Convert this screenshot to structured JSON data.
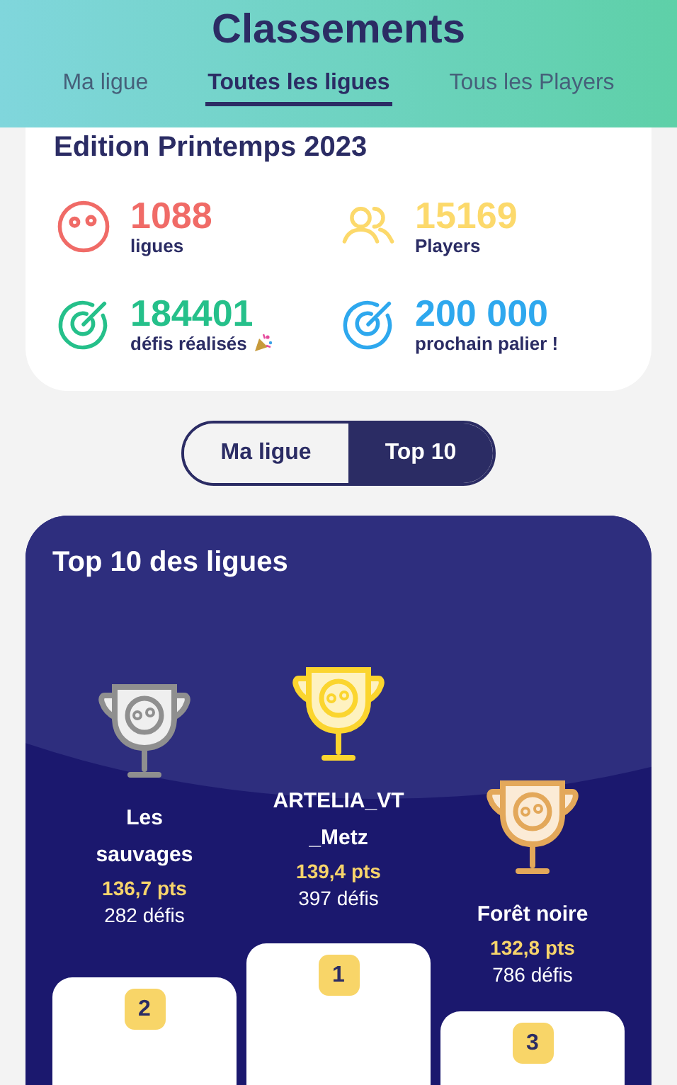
{
  "header": {
    "title": "Classements"
  },
  "tabs": [
    {
      "label": "Ma ligue",
      "selected": false
    },
    {
      "label": "Toutes les ligues",
      "selected": true
    },
    {
      "label": "Tous les Players",
      "selected": false
    }
  ],
  "edition": {
    "title": "Edition Printemps 2023",
    "stats": [
      {
        "kind": "face",
        "color": "#f06b67",
        "value": "1088",
        "label": "ligues"
      },
      {
        "kind": "people",
        "color": "#fcd96b",
        "value": "15169",
        "label": "Players"
      },
      {
        "kind": "target",
        "color": "#25c08a",
        "value": "184401",
        "label": "défis réalisés",
        "party": true
      },
      {
        "kind": "target",
        "color": "#2ea8ee",
        "value": "200 000",
        "label": "prochain palier !"
      }
    ]
  },
  "toggle": [
    {
      "label": "Ma ligue",
      "selected": false
    },
    {
      "label": "Top 10",
      "selected": true
    }
  ],
  "top10": {
    "title": "Top 10 des ligues",
    "podium": [
      {
        "kind": "silver",
        "name": "Les sauvages",
        "points": "136,7 pts",
        "defis": "282 défis",
        "rank": "2"
      },
      {
        "kind": "gold",
        "name": "ARTELIA_VT_Metz",
        "points": "139,4 pts",
        "defis": "397 défis",
        "rank": "1"
      },
      {
        "kind": "bronze",
        "name": "Forêt noire",
        "points": "132,8 pts",
        "defis": "786 défis",
        "rank": "3"
      }
    ]
  }
}
